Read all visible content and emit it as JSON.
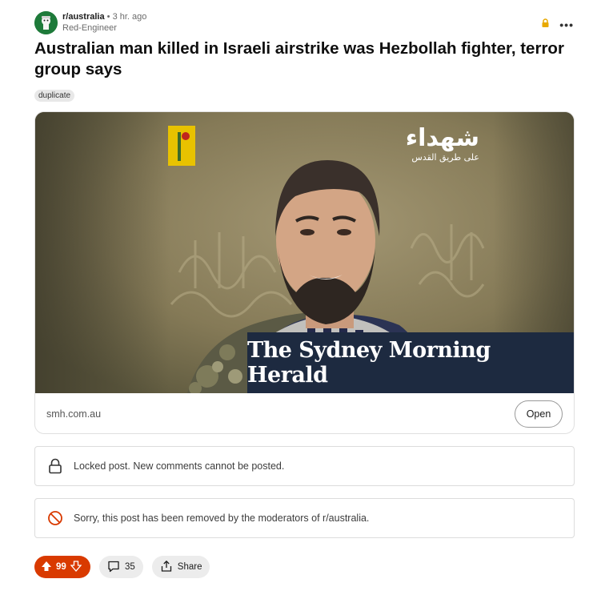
{
  "header": {
    "subreddit": "r/australia",
    "separator": "•",
    "time": "3 hr. ago",
    "author": "Red-Engineer",
    "icons": [
      "lock-icon",
      "more-icon"
    ]
  },
  "post": {
    "title": "Australian man killed in Israeli airstrike was Hezbollah fighter, terror group says",
    "flair": "duplicate"
  },
  "media": {
    "image_arabic_title": "شهداء",
    "image_arabic_subtitle": "على طريق القدس",
    "image_watermark": "The Sydney Morning Herald",
    "domain": "smh.com.au",
    "open_label": "Open"
  },
  "notices": {
    "locked": "Locked post. New comments cannot be posted.",
    "removed": "Sorry, this post has been removed by the moderators of r/australia."
  },
  "actions": {
    "votes": "99",
    "comments": "35",
    "share_label": "Share"
  },
  "colors": {
    "accent": "#d93a00",
    "lock": "#e8a900",
    "removed_icon": "#d93a00",
    "avatar_bg": "#1e7a3a"
  }
}
